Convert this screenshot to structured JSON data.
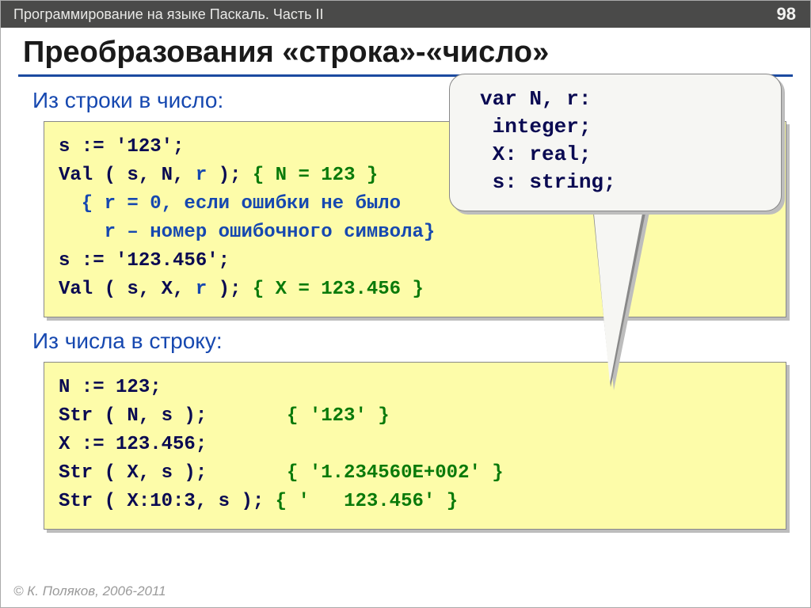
{
  "topbar": {
    "title": "Программирование на языке Паскаль. Часть II",
    "page": "98"
  },
  "title": "Преобразования «строка»-«число»",
  "section1": {
    "label": "Из строки в число:"
  },
  "code1": {
    "l1a": "s := ",
    "l1b": "'123'",
    "l1c": ";",
    "l2a": "Val ( s, N, ",
    "l2b": "r",
    "l2c": " ); ",
    "l2d": "{ N = 123 }",
    "l3a": "  { ",
    "l3b": "r = 0",
    "l3c": ", если ошибки не было",
    "l4a": "    ",
    "l4b": "r",
    "l4c": " – номер ошибочного символа}",
    "l5a": "s := ",
    "l5b": "'123.456'",
    "l5c": ";",
    "l6a": "Val ( s, X, ",
    "l6b": "r",
    "l6c": " ); ",
    "l6d": "{ X = 123.456 }"
  },
  "section2": {
    "label": "Из числа в строку:"
  },
  "code2": {
    "l1a": "N := ",
    "l1b": "123",
    "l1c": ";",
    "l2a": "Str ( N, s );       ",
    "l2b": "{ '123' }",
    "l3a": "X := ",
    "l3b": "123.456",
    "l3c": ";",
    "l4a": "Str ( X, s );       ",
    "l4b": "{ '1.234560E+002' }",
    "l5a": "Str ( X:10:3, s ); ",
    "l5b": "{ '   123.456' }"
  },
  "callout": {
    "l1": "var N, r:",
    "l2": " integer;",
    "l3": " X: real;",
    "l4": " s: string;"
  },
  "footer": "© К. Поляков, 2006-2011"
}
